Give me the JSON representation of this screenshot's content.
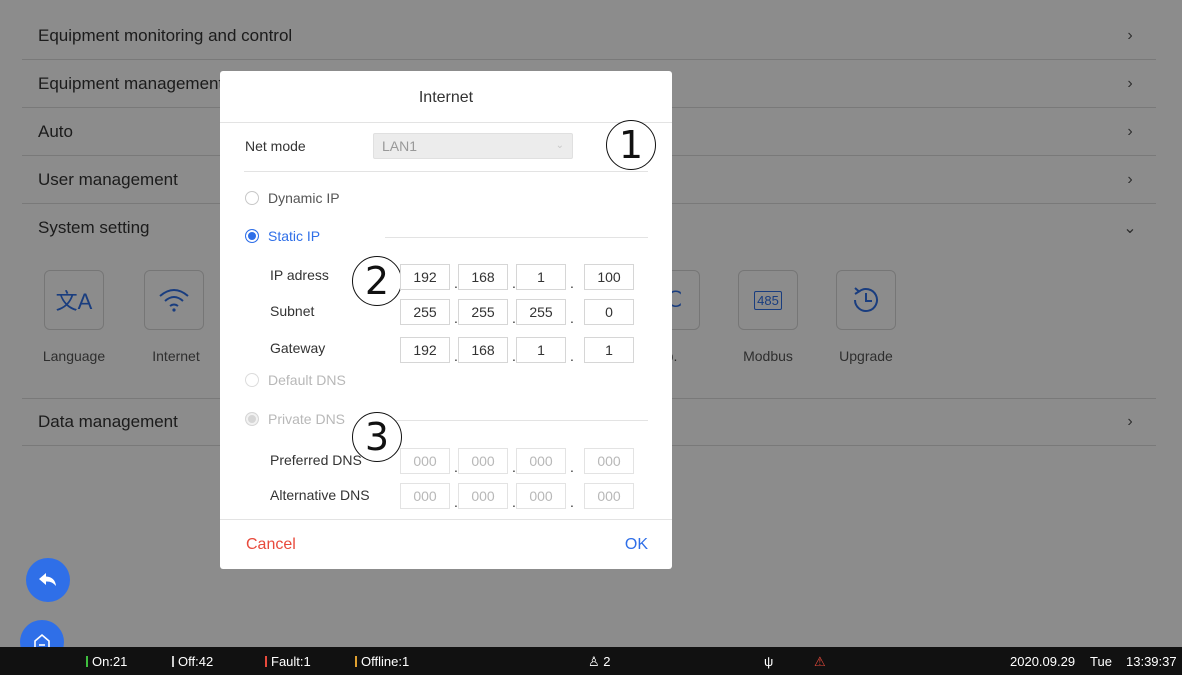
{
  "menu": {
    "items": [
      {
        "label": "Equipment monitoring and control"
      },
      {
        "label": "Equipment management"
      },
      {
        "label": "Auto"
      },
      {
        "label": "User management"
      },
      {
        "label": "System setting"
      },
      {
        "label": "Data management"
      }
    ]
  },
  "system_setting": {
    "tiles": [
      {
        "label": "Language",
        "icon": "translate-icon"
      },
      {
        "label": "Internet",
        "icon": "wifi-icon"
      },
      {
        "label": "Temp.",
        "icon": "temperature-icon"
      },
      {
        "label": "Modbus",
        "icon": "modbus-485-icon",
        "badge": "485"
      },
      {
        "label": "Upgrade",
        "icon": "clock-upgrade-icon"
      }
    ],
    "partial_label_visible": "mp."
  },
  "dialog": {
    "title": "Internet",
    "net_mode": {
      "label": "Net mode",
      "value": "LAN1"
    },
    "dynamic_ip_label": "Dynamic IP",
    "static_ip_label": "Static IP",
    "ip_address": {
      "label": "IP adress",
      "octets": [
        "192",
        "168",
        "1",
        "100"
      ]
    },
    "subnet": {
      "label": "Subnet",
      "octets": [
        "255",
        "255",
        "255",
        "0"
      ]
    },
    "gateway": {
      "label": "Gateway",
      "octets": [
        "192",
        "168",
        "1",
        "1"
      ]
    },
    "default_dns_label": "Default DNS",
    "private_dns_label": "Private DNS",
    "preferred_dns": {
      "label": "Preferred DNS",
      "octets": [
        "000",
        "000",
        "000",
        "000"
      ]
    },
    "alternative_dns": {
      "label": "Alternative DNS",
      "octets": [
        "000",
        "000",
        "000",
        "000"
      ]
    },
    "cancel_label": "Cancel",
    "ok_label": "OK",
    "callouts": [
      "1",
      "2",
      "3"
    ]
  },
  "statusbar": {
    "on": "On:21",
    "off": "Off:42",
    "fault": "Fault:1",
    "offline": "Offline:1",
    "users": "2",
    "date": "2020.09.29",
    "weekday": "Tue",
    "time": "13:39:37"
  },
  "colors": {
    "accent": "#2f6fe8",
    "cancel": "#e84a3c",
    "status_on": "#3fbf3f",
    "status_fault": "#e84a3c",
    "status_off": "#cccccc"
  }
}
